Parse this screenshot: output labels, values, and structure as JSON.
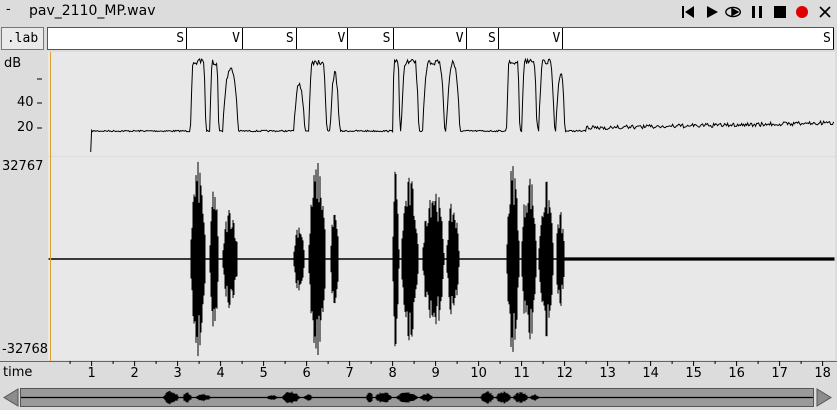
{
  "window": {
    "menu_glyph": "-",
    "title": "pav_2110_MP.wav"
  },
  "toolbar": {
    "buttons": [
      {
        "name": "skip-to-start-icon"
      },
      {
        "name": "play-icon"
      },
      {
        "name": "loop-play-icon"
      },
      {
        "name": "pause-icon"
      },
      {
        "name": "stop-icon"
      },
      {
        "name": "record-icon",
        "color": "#e00000"
      },
      {
        "name": "close-icon"
      }
    ]
  },
  "label_tier": {
    "button_label": ".lab",
    "segments": [
      {
        "label": "S",
        "end": 3.2
      },
      {
        "label": "V",
        "end": 4.5
      },
      {
        "label": "S",
        "end": 5.75
      },
      {
        "label": "V",
        "end": 6.95
      },
      {
        "label": "S",
        "end": 8.0
      },
      {
        "label": "V",
        "end": 9.7
      },
      {
        "label": "S",
        "end": 10.45
      },
      {
        "label": "V",
        "end": 11.95
      },
      {
        "label": "S",
        "end": 18.4
      }
    ]
  },
  "energy_panel": {
    "unit_label": "dB",
    "ticks": [
      {
        "label": "40",
        "value": 40
      },
      {
        "label": "20",
        "value": 20
      }
    ]
  },
  "waveform_panel": {
    "max_label": "32767",
    "min_label": "-32768"
  },
  "time_axis": {
    "label": "time",
    "ticks": [
      "1",
      "2",
      "3",
      "4",
      "5",
      "6",
      "7",
      "8",
      "9",
      "10",
      "11",
      "12",
      "13",
      "14",
      "15",
      "16",
      "17",
      "18"
    ]
  },
  "colors": {
    "cursor": "#e0a030",
    "record": "#e00000"
  }
}
